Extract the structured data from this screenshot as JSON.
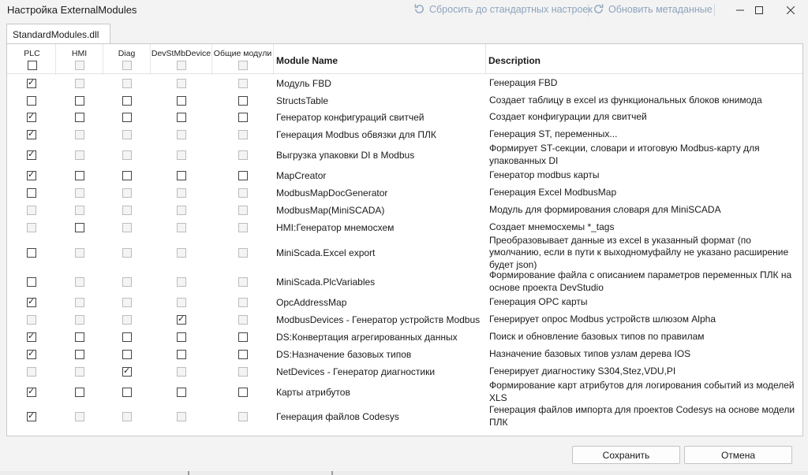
{
  "window": {
    "title": "Настройка ExternalModules",
    "reset_label": "Сбросить до стандартных настроек",
    "refresh_label": "Обновить метаданные"
  },
  "tabs": [
    {
      "label": "StandardModules.dll"
    }
  ],
  "columns": {
    "checks": [
      "PLC",
      "HMI",
      "Diag",
      "DevStMbDevice",
      "Общие модули"
    ],
    "name": "Module Name",
    "description": "Description"
  },
  "header_checks": [
    {
      "checked": false,
      "disabled": false
    },
    {
      "checked": false,
      "disabled": true
    },
    {
      "checked": false,
      "disabled": true
    },
    {
      "checked": false,
      "disabled": true
    },
    {
      "checked": false,
      "disabled": true
    }
  ],
  "rows": [
    {
      "name": "Модуль FBD",
      "description": "Генерация FBD",
      "checks": [
        [
          true,
          false
        ],
        [
          false,
          true
        ],
        [
          false,
          true
        ],
        [
          false,
          true
        ],
        [
          false,
          true
        ]
      ]
    },
    {
      "name": "StructsTable",
      "description": "Создает таблицу в excel из функциональных блоков юнимода",
      "checks": [
        [
          false,
          false
        ],
        [
          false,
          false
        ],
        [
          false,
          false
        ],
        [
          false,
          false
        ],
        [
          false,
          false
        ]
      ]
    },
    {
      "name": "Генератор конфигураций свитчей",
      "description": "Создает конфигурации для свитчей",
      "checks": [
        [
          true,
          false
        ],
        [
          false,
          false
        ],
        [
          false,
          false
        ],
        [
          false,
          false
        ],
        [
          false,
          false
        ]
      ]
    },
    {
      "name": "Генерация Modbus обвязки для ПЛК",
      "description": "Генерация ST, переменных...",
      "checks": [
        [
          true,
          false
        ],
        [
          false,
          true
        ],
        [
          false,
          true
        ],
        [
          false,
          true
        ],
        [
          false,
          true
        ]
      ]
    },
    {
      "name": "Выгрузка упаковки DI в Modbus",
      "description": "Формирует ST-секции, словари и итоговую Modbus-карту для упакованных DI",
      "checks": [
        [
          true,
          false
        ],
        [
          false,
          true
        ],
        [
          false,
          true
        ],
        [
          false,
          true
        ],
        [
          false,
          true
        ]
      ]
    },
    {
      "name": "MapCreator",
      "description": "Генератор modbus карты",
      "checks": [
        [
          true,
          false
        ],
        [
          false,
          false
        ],
        [
          false,
          false
        ],
        [
          false,
          false
        ],
        [
          false,
          false
        ]
      ]
    },
    {
      "name": "ModbusMapDocGenerator",
      "description": "Генерация Excel ModbusMap",
      "checks": [
        [
          false,
          false
        ],
        [
          false,
          true
        ],
        [
          false,
          true
        ],
        [
          false,
          true
        ],
        [
          false,
          true
        ]
      ]
    },
    {
      "name": "ModbusMap(MiniSCADA)",
      "description": "Модуль для формирования словаря для MiniSCADA",
      "checks": [
        [
          false,
          true
        ],
        [
          false,
          true
        ],
        [
          false,
          true
        ],
        [
          false,
          true
        ],
        [
          false,
          true
        ]
      ]
    },
    {
      "name": "HMI:Генератор мнемосхем",
      "description": "Создает мнемосхемы *_tags",
      "checks": [
        [
          false,
          true
        ],
        [
          false,
          false
        ],
        [
          false,
          true
        ],
        [
          false,
          true
        ],
        [
          false,
          true
        ]
      ]
    },
    {
      "name": "MiniScada.Excel export",
      "description": "Преобразовывает данные из excel в указанный формат (по умолчанию, если в пути к выходномуфайлу не указано расширение будет json)",
      "checks": [
        [
          false,
          false
        ],
        [
          false,
          true
        ],
        [
          false,
          true
        ],
        [
          false,
          true
        ],
        [
          false,
          true
        ]
      ]
    },
    {
      "name": "MiniScada.PlcVariables",
      "description": "Формирование файла с описанием параметров переменных ПЛК на основе проекта DevStudio",
      "checks": [
        [
          false,
          false
        ],
        [
          false,
          true
        ],
        [
          false,
          true
        ],
        [
          false,
          true
        ],
        [
          false,
          true
        ]
      ]
    },
    {
      "name": "OpcAddressMap",
      "description": "Генерация OPC карты",
      "checks": [
        [
          true,
          false
        ],
        [
          false,
          true
        ],
        [
          false,
          true
        ],
        [
          false,
          true
        ],
        [
          false,
          true
        ]
      ]
    },
    {
      "name": "ModbusDevices - Генератор устройств Modbus",
      "description": "Генерирует опрос Modbus устройств шлюзом Alpha",
      "checks": [
        [
          false,
          true
        ],
        [
          false,
          true
        ],
        [
          false,
          true
        ],
        [
          true,
          false
        ],
        [
          false,
          true
        ]
      ]
    },
    {
      "name": "DS:Конвертация агрегированных данных",
      "description": "Поиск и обновление базовых типов по правилам",
      "checks": [
        [
          true,
          false
        ],
        [
          false,
          false
        ],
        [
          false,
          false
        ],
        [
          false,
          false
        ],
        [
          false,
          false
        ]
      ]
    },
    {
      "name": "DS:Назначение базовых типов",
      "description": "Назначение базовых типов узлам дерева IOS",
      "checks": [
        [
          true,
          false
        ],
        [
          false,
          false
        ],
        [
          false,
          false
        ],
        [
          false,
          false
        ],
        [
          false,
          false
        ]
      ]
    },
    {
      "name": "NetDevices - Генератор диагностики",
      "description": "Генерирует диагностику S304,Stez,VDU,PI",
      "checks": [
        [
          false,
          true
        ],
        [
          false,
          true
        ],
        [
          true,
          false
        ],
        [
          false,
          true
        ],
        [
          false,
          true
        ]
      ]
    },
    {
      "name": "Карты атрибутов",
      "description": "Формирование карт атрибутов для логирования событий из моделей XLS",
      "checks": [
        [
          true,
          false
        ],
        [
          false,
          false
        ],
        [
          false,
          false
        ],
        [
          false,
          false
        ],
        [
          false,
          false
        ]
      ]
    },
    {
      "name": "Генерация файлов Codesys",
      "description": "Генерация файлов импорта для проектов Codesys на основе модели ПЛК",
      "checks": [
        [
          true,
          false
        ],
        [
          false,
          true
        ],
        [
          false,
          true
        ],
        [
          false,
          true
        ],
        [
          false,
          true
        ]
      ]
    }
  ],
  "buttons": {
    "save": "Сохранить",
    "cancel": "Отмена"
  },
  "icons": {
    "reset": "reset-icon",
    "refresh": "refresh-icon",
    "minimize": "minimize-icon",
    "maximize": "maximize-icon",
    "close": "close-icon"
  },
  "colors": {
    "toolbar_action": "#8da4bd",
    "window_bg": "#f3f3f3",
    "panel_bg": "#ffffff"
  }
}
